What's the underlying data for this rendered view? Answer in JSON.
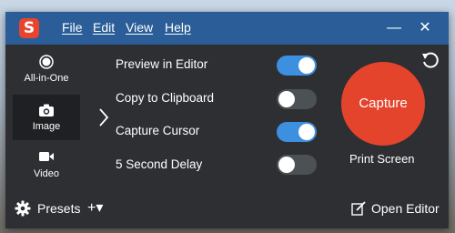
{
  "app": {
    "logo_letter": "S"
  },
  "menu": {
    "file": "File",
    "edit": "Edit",
    "view": "View",
    "help": "Help"
  },
  "window_controls": {
    "minimize": "—",
    "close": "✕"
  },
  "modes": [
    {
      "label": "All-in-One",
      "icon": "circle-record-icon",
      "selected": false
    },
    {
      "label": "Image",
      "icon": "camera-icon",
      "selected": true
    },
    {
      "label": "Video",
      "icon": "video-camera-icon",
      "selected": false
    }
  ],
  "options": [
    {
      "label": "Preview in Editor",
      "on": true
    },
    {
      "label": "Copy to Clipboard",
      "on": false
    },
    {
      "label": "Capture Cursor",
      "on": true
    },
    {
      "label": "5 Second Delay",
      "on": false
    }
  ],
  "capture": {
    "label": "Capture",
    "shortcut": "Print Screen"
  },
  "bottom": {
    "presets_label": "Presets",
    "add_label": "+▾",
    "open_editor_label": "Open Editor"
  },
  "colors": {
    "titlebar": "#2b5d98",
    "body": "#2d2f33",
    "capture": "#e5442c",
    "toggle_on": "#3d8fe0",
    "toggle_off": "#4c5154"
  }
}
